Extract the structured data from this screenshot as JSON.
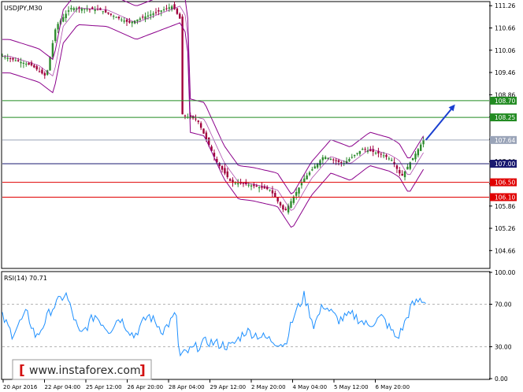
{
  "window": {
    "title": "USDJPY,M30",
    "rsi_label": "RSI(14) 70.71",
    "watermark": "www.instaforex.com"
  },
  "colors": {
    "candle_up": "#2e8b2e",
    "candle_down": "#a0003c",
    "bollinger": "#8b008b",
    "rsi_line": "#1e90ff",
    "resistance": "#228b22",
    "pivot": "#191970",
    "support": "#e00000",
    "current_price": "#9aa4b8",
    "forecast_arrow": "#1a3fd0",
    "watermark_red": "#d21010"
  },
  "chart_data": [
    {
      "type": "candlestick",
      "symbol": "USDJPY",
      "timeframe": "M30",
      "title": "USDJPY,M30",
      "ylim": [
        104.2,
        111.35
      ],
      "y_ticks": [
        "111.26",
        "110.66",
        "110.06",
        "109.46",
        "108.86",
        "108.26",
        "107.66",
        "107.06",
        "106.46",
        "105.86",
        "105.26",
        "104.66"
      ],
      "x_tick_labels": [
        "20 Apr 2016",
        "22 Apr 04:00",
        "25 Apr 12:00",
        "26 Apr 20:00",
        "28 Apr 04:00",
        "29 Apr 12:00",
        "2 May 20:00",
        "4 May 04:00",
        "5 May 12:00",
        "6 May 20:00"
      ],
      "levels": [
        {
          "value": 108.7,
          "label": "108.70",
          "role": "resistance"
        },
        {
          "value": 108.25,
          "label": "108.25",
          "role": "resistance"
        },
        {
          "value": 107.64,
          "label": "107.64",
          "role": "current"
        },
        {
          "value": 107.0,
          "label": "107.00",
          "role": "pivot"
        },
        {
          "value": 106.5,
          "label": "106.50",
          "role": "support"
        },
        {
          "value": 106.1,
          "label": "106.10",
          "role": "support"
        }
      ],
      "price_path": [
        [
          0,
          109.9
        ],
        [
          0.06,
          109.65
        ],
        [
          0.09,
          109.35
        ],
        [
          0.11,
          110.7
        ],
        [
          0.14,
          111.2
        ],
        [
          0.2,
          111.15
        ],
        [
          0.26,
          110.8
        ],
        [
          0.3,
          111.0
        ],
        [
          0.35,
          111.25
        ],
        [
          0.365,
          110.9
        ],
        [
          0.37,
          108.3
        ],
        [
          0.4,
          108.2
        ],
        [
          0.44,
          107.05
        ],
        [
          0.47,
          106.5
        ],
        [
          0.5,
          106.45
        ],
        [
          0.55,
          106.3
        ],
        [
          0.58,
          105.7
        ],
        [
          0.62,
          106.6
        ],
        [
          0.66,
          107.2
        ],
        [
          0.7,
          107.0
        ],
        [
          0.74,
          107.4
        ],
        [
          0.78,
          107.25
        ],
        [
          0.8,
          107.1
        ],
        [
          0.82,
          106.65
        ],
        [
          0.85,
          107.3
        ],
        [
          0.865,
          107.64
        ]
      ],
      "bollinger_width": 0.45,
      "forecast": {
        "from": [
          0.87,
          107.64
        ],
        "to": [
          0.93,
          108.6
        ]
      }
    },
    {
      "type": "line",
      "title": "RSI(14) 70.71",
      "series": [
        {
          "name": "RSI(14)",
          "last": 70.71
        }
      ],
      "ylim": [
        0,
        100
      ],
      "y_ticks": [
        "100.00",
        "70.00",
        "30.00",
        "0.00"
      ],
      "levels": [
        70,
        30
      ],
      "rsi_path": [
        [
          0,
          58
        ],
        [
          0.02,
          42
        ],
        [
          0.05,
          62
        ],
        [
          0.07,
          38
        ],
        [
          0.1,
          65
        ],
        [
          0.13,
          80
        ],
        [
          0.16,
          40
        ],
        [
          0.19,
          60
        ],
        [
          0.22,
          45
        ],
        [
          0.24,
          58
        ],
        [
          0.27,
          40
        ],
        [
          0.3,
          60
        ],
        [
          0.33,
          45
        ],
        [
          0.36,
          62
        ],
        [
          0.362,
          20
        ],
        [
          0.38,
          25
        ],
        [
          0.42,
          35
        ],
        [
          0.47,
          30
        ],
        [
          0.5,
          45
        ],
        [
          0.53,
          40
        ],
        [
          0.56,
          35
        ],
        [
          0.58,
          32
        ],
        [
          0.6,
          60
        ],
        [
          0.62,
          78
        ],
        [
          0.64,
          50
        ],
        [
          0.66,
          70
        ],
        [
          0.69,
          55
        ],
        [
          0.72,
          60
        ],
        [
          0.75,
          50
        ],
        [
          0.78,
          58
        ],
        [
          0.81,
          38
        ],
        [
          0.82,
          45
        ],
        [
          0.84,
          68
        ],
        [
          0.86,
          75
        ],
        [
          0.87,
          70.71
        ]
      ]
    }
  ]
}
